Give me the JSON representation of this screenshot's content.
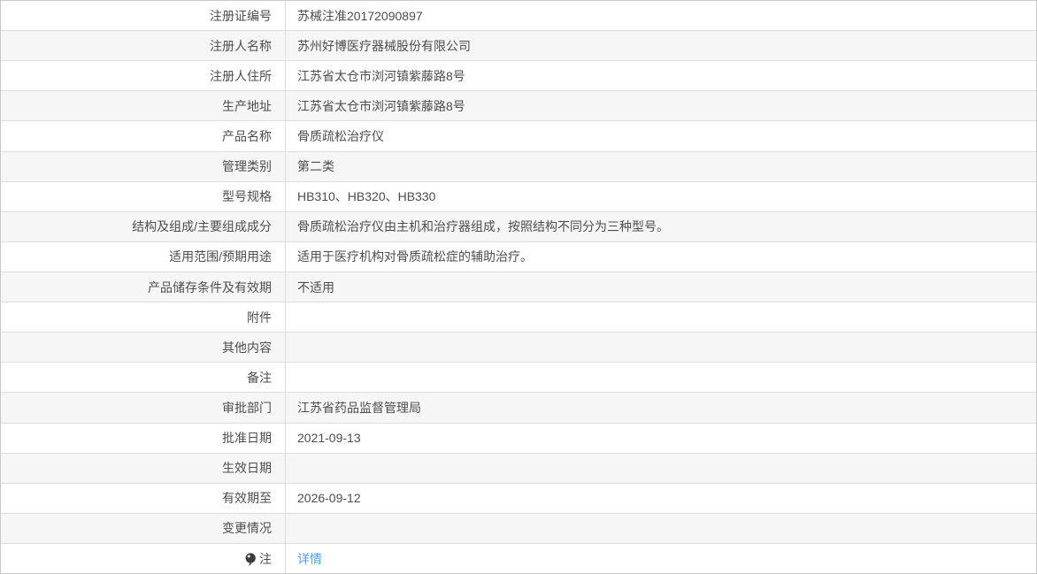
{
  "colors": {
    "link_blue": "#4c9ef0",
    "row_alt_bg": "#f6f6f6",
    "border": "#dcdcdc",
    "text": "#4d4d4d"
  },
  "registration_table": {
    "rows": [
      {
        "label": "注册证编号",
        "value": "苏械注准20172090897"
      },
      {
        "label": "注册人名称",
        "value": "苏州好博医疗器械股份有限公司"
      },
      {
        "label": "注册人住所",
        "value": "江苏省太仓市浏河镇紫藤路8号"
      },
      {
        "label": "生产地址",
        "value": "江苏省太仓市浏河镇紫藤路8号"
      },
      {
        "label": "产品名称",
        "value": "骨质疏松治疗仪"
      },
      {
        "label": "管理类别",
        "value": "第二类"
      },
      {
        "label": "型号规格",
        "value": "HB310、HB320、HB330"
      },
      {
        "label": "结构及组成/主要组成成分",
        "value": "骨质疏松治疗仪由主机和治疗器组成，按照结构不同分为三种型号。"
      },
      {
        "label": "适用范围/预期用途",
        "value": "适用于医疗机构对骨质疏松症的辅助治疗。"
      },
      {
        "label": "产品储存条件及有效期",
        "value": "不适用"
      },
      {
        "label": "附件",
        "value": ""
      },
      {
        "label": "其他内容",
        "value": ""
      },
      {
        "label": "备注",
        "value": ""
      },
      {
        "label": "审批部门",
        "value": "江苏省药品监督管理局"
      },
      {
        "label": "批准日期",
        "value": "2021-09-13"
      },
      {
        "label": "生效日期",
        "value": ""
      },
      {
        "label": "有效期至",
        "value": "2026-09-12"
      },
      {
        "label": "变更情况",
        "value": ""
      },
      {
        "label": "注",
        "value": "详情",
        "value_is_link": true,
        "label_icon": "balloon-icon"
      }
    ]
  }
}
